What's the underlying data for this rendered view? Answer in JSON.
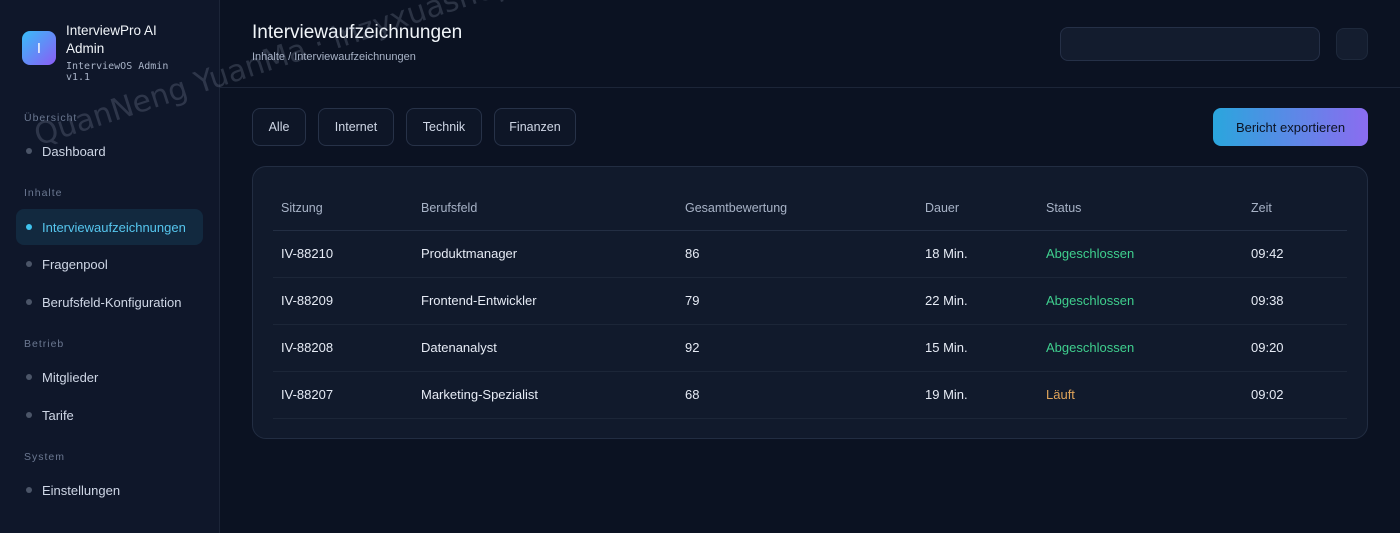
{
  "brand": {
    "logo_letter": "I",
    "name": "InterviewPro AI Admin",
    "version": "InterviewOS Admin v1.1"
  },
  "sidebar": {
    "sections": [
      {
        "title": "Übersicht",
        "items": [
          {
            "label": "Dashboard"
          }
        ]
      },
      {
        "title": "Inhalte",
        "items": [
          {
            "label": "Interviewaufzeichnungen",
            "active": true
          },
          {
            "label": "Fragenpool"
          },
          {
            "label": "Berufsfeld-Konfiguration"
          }
        ]
      },
      {
        "title": "Betrieb",
        "items": [
          {
            "label": "Mitglieder"
          },
          {
            "label": "Tarife"
          }
        ]
      },
      {
        "title": "System",
        "items": [
          {
            "label": "Einstellungen"
          }
        ]
      }
    ]
  },
  "header": {
    "title": "Interviewaufzeichnungen",
    "breadcrumb": "Inhalte / Interviewaufzeichnungen"
  },
  "search": {
    "placeholder": ""
  },
  "filters": [
    "Alle",
    "Internet",
    "Technik",
    "Finanzen"
  ],
  "export_label": "Bericht exportieren",
  "table": {
    "columns": [
      "Sitzung",
      "Berufsfeld",
      "Gesamtbewertung",
      "Dauer",
      "Status",
      "Zeit"
    ],
    "rows": [
      {
        "session": "IV-88210",
        "field": "Produktmanager",
        "score": "86",
        "duration": "18 Min.",
        "status": "Abgeschlossen",
        "time": "09:42"
      },
      {
        "session": "IV-88209",
        "field": "Frontend-Entwickler",
        "score": "79",
        "duration": "22 Min.",
        "status": "Abgeschlossen",
        "time": "09:38"
      },
      {
        "session": "IV-88208",
        "field": "Datenanalyst",
        "score": "92",
        "duration": "15 Min.",
        "status": "Abgeschlossen",
        "time": "09:20"
      },
      {
        "session": "IV-88207",
        "field": "Marketing-Spezialist",
        "score": "68",
        "duration": "19 Min.",
        "status": "Läuft",
        "time": "09:02"
      }
    ]
  },
  "watermark": "QuanNeng YuanMa · inzyxuashop.com",
  "colors": {
    "background": "#0b1222",
    "sidebar": "#0f172a",
    "accent": "#3fc3ee",
    "status_done": "#3fcf8e",
    "status_running": "#e0a45a"
  }
}
